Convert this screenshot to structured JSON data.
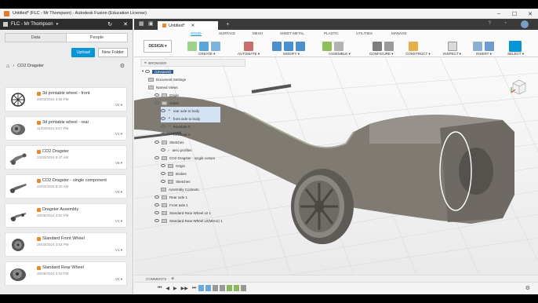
{
  "window": {
    "title": "Untitled* (FLC - Mr Thompson) - Autodesk Fusion (Education License)"
  },
  "data_panel": {
    "team": "FLC - Mr Thompson",
    "tabs": [
      "Data",
      "People"
    ],
    "upload_label": "Upload",
    "new_folder_label": "New Folder",
    "breadcrumb": "CO2 Dragster",
    "items": [
      {
        "name": "3d printable wheel - front",
        "date": "20/03/2024 3:56 PM",
        "version": "V2"
      },
      {
        "name": "3d printable wheel - rear",
        "date": "11/03/2024 8:57 PM",
        "version": "V1"
      },
      {
        "name": "CO2 Dragster",
        "date": "22/03/2024 8:47 AM",
        "version": "V6"
      },
      {
        "name": "CO2 Dragster - single component",
        "date": "22/03/2024 8:43 AM",
        "version": "V3"
      },
      {
        "name": "Dragster Assembly",
        "date": "26/09/2024 4:52 PM",
        "version": "V1"
      },
      {
        "name": "Standard Front Wheel",
        "date": "25/03/2024 3:52 PM",
        "version": "V1"
      },
      {
        "name": "Standard Rear Wheel",
        "date": "26/09/2024 3:53 PM",
        "version": "V2"
      }
    ]
  },
  "document_tab": {
    "label": "Untitled*"
  },
  "toolbar": {
    "workspace": "DESIGN",
    "tabs": [
      "SOLID",
      "SURFACE",
      "MESH",
      "SHEET METAL",
      "PLASTIC",
      "UTILITIES",
      "MANAGE"
    ],
    "groups": [
      "CREATE",
      "AUTOMATE",
      "MODIFY",
      "ASSEMBLE",
      "CONFIGURE",
      "CONSTRUCT",
      "INSPECT",
      "INSERT",
      "SELECT"
    ]
  },
  "browser": {
    "title": "BROWSER",
    "root": "(Unsaved)",
    "rows": [
      "Document Settings",
      "Named Views",
      "Origin",
      "Joints",
      "rear axle to body",
      "front axle to body",
      "Revolute 3",
      "Revolute 4",
      "Sketches",
      "aero profiles",
      "CO2 Dragster - single compo",
      "Origin",
      "Bodies",
      "Sketches",
      "Assembly Contexts",
      "Rear axle 1",
      "Front axle 1",
      "Standard Rear Wheel v2 1",
      "Standard Rear Wheel v2(Mirror) 1"
    ]
  },
  "comments_label": "COMMENTS",
  "colors": {
    "accent": "#0696d7",
    "folder": "#e98a2a",
    "titlebar_dark": "#2d2d2d"
  }
}
